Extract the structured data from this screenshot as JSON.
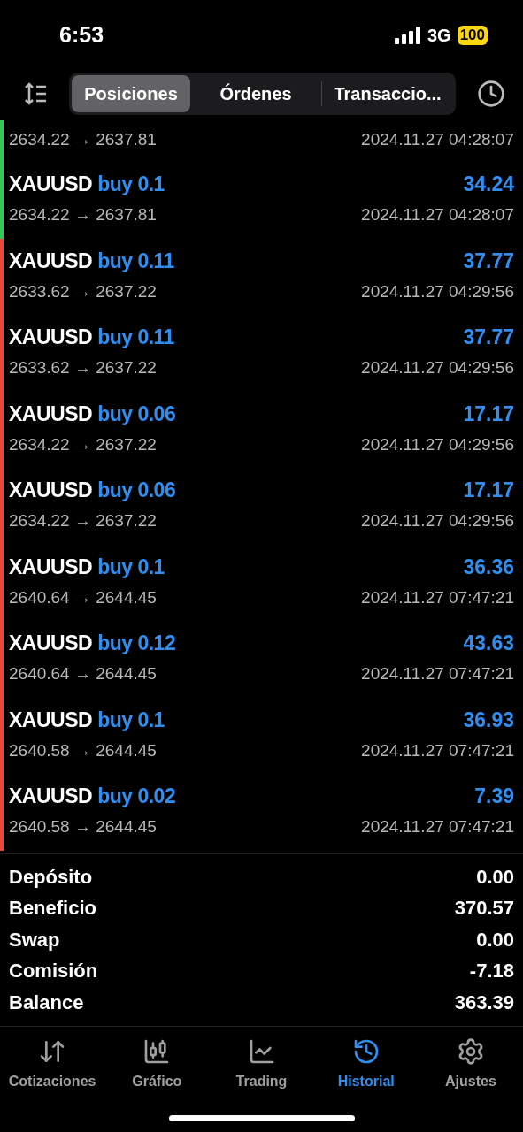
{
  "status_bar": {
    "time": "6:53",
    "network": "3G",
    "battery": "100"
  },
  "tabs": [
    {
      "label": "Posiciones",
      "selected": true
    },
    {
      "label": "Órdenes",
      "selected": false
    },
    {
      "label": "Transaccio...",
      "selected": false
    }
  ],
  "trades": [
    {
      "kind": "partial",
      "color": "#34c759",
      "prices": "2634.22 → 2637.81",
      "time": "2024.11.27 04:28:07"
    },
    {
      "kind": "full",
      "color": "#34c759",
      "symbol": "XAUUSD",
      "side": "buy 0.1",
      "profit": "34.24",
      "prices": "2634.22 → 2637.81",
      "time": "2024.11.27 04:28:07"
    },
    {
      "kind": "full",
      "color": "#e5483c",
      "symbol": "XAUUSD",
      "side": "buy 0.11",
      "profit": "37.77",
      "prices": "2633.62 → 2637.22",
      "time": "2024.11.27 04:29:56"
    },
    {
      "kind": "full",
      "color": "#e5483c",
      "symbol": "XAUUSD",
      "side": "buy 0.11",
      "profit": "37.77",
      "prices": "2633.62 → 2637.22",
      "time": "2024.11.27 04:29:56"
    },
    {
      "kind": "full",
      "color": "#e5483c",
      "symbol": "XAUUSD",
      "side": "buy 0.06",
      "profit": "17.17",
      "prices": "2634.22 → 2637.22",
      "time": "2024.11.27 04:29:56"
    },
    {
      "kind": "full",
      "color": "#e5483c",
      "symbol": "XAUUSD",
      "side": "buy 0.06",
      "profit": "17.17",
      "prices": "2634.22 → 2637.22",
      "time": "2024.11.27 04:29:56"
    },
    {
      "kind": "full",
      "color": "#e5483c",
      "symbol": "XAUUSD",
      "side": "buy 0.1",
      "profit": "36.36",
      "prices": "2640.64 → 2644.45",
      "time": "2024.11.27 07:47:21"
    },
    {
      "kind": "full",
      "color": "#e5483c",
      "symbol": "XAUUSD",
      "side": "buy 0.12",
      "profit": "43.63",
      "prices": "2640.64 → 2644.45",
      "time": "2024.11.27 07:47:21"
    },
    {
      "kind": "full",
      "color": "#e5483c",
      "symbol": "XAUUSD",
      "side": "buy 0.1",
      "profit": "36.93",
      "prices": "2640.58 → 2644.45",
      "time": "2024.11.27 07:47:21"
    },
    {
      "kind": "full",
      "color": "#e5483c",
      "symbol": "XAUUSD",
      "side": "buy 0.02",
      "profit": "7.39",
      "prices": "2640.58 → 2644.45",
      "time": "2024.11.27 07:47:21"
    }
  ],
  "summary": [
    {
      "label": "Depósito",
      "value": "0.00"
    },
    {
      "label": "Beneficio",
      "value": "370.57"
    },
    {
      "label": "Swap",
      "value": "0.00"
    },
    {
      "label": "Comisión",
      "value": "-7.18"
    },
    {
      "label": "Balance",
      "value": "363.39"
    }
  ],
  "nav": [
    {
      "kind": "quotes",
      "label": "Cotizaciones",
      "selected": false
    },
    {
      "kind": "chart",
      "label": "Gráfico",
      "selected": false
    },
    {
      "kind": "trading",
      "label": "Trading",
      "selected": false
    },
    {
      "kind": "history",
      "label": "Historial",
      "selected": true
    },
    {
      "kind": "settings",
      "label": "Ajustes",
      "selected": false
    }
  ]
}
